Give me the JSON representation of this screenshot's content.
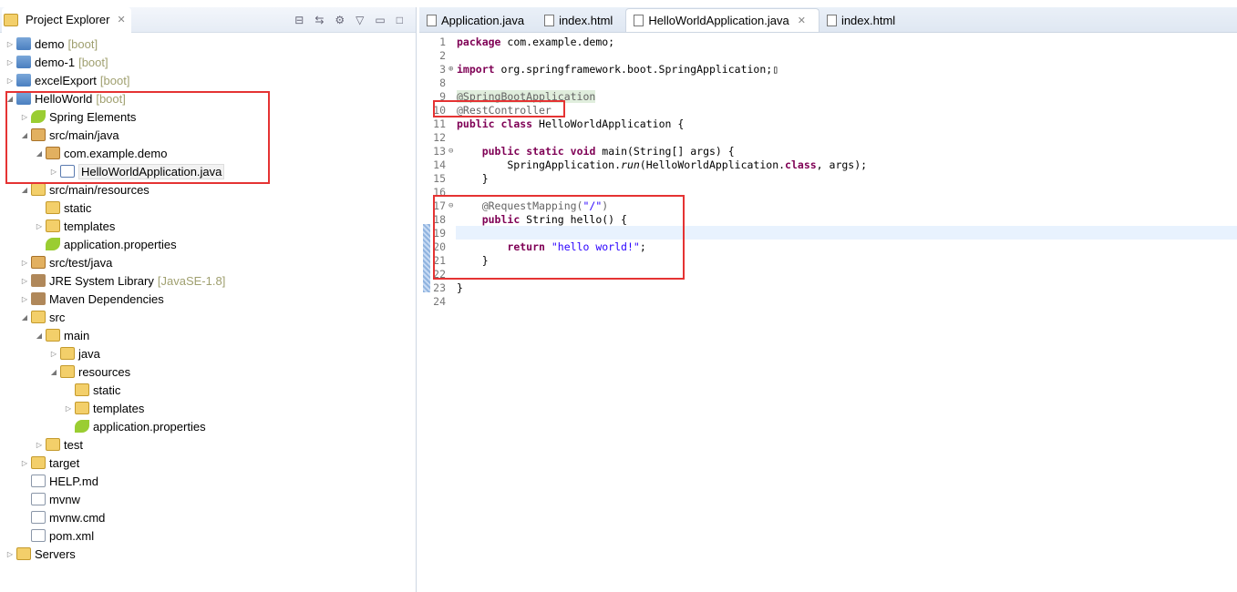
{
  "explorer": {
    "title": "Project Explorer",
    "items": [
      {
        "label": "demo",
        "deco": "[boot]",
        "level": 0,
        "state": "collapsed",
        "icon": "project"
      },
      {
        "label": "demo-1",
        "deco": "[boot]",
        "level": 0,
        "state": "collapsed",
        "icon": "project"
      },
      {
        "label": "excelExport",
        "deco": "[boot]",
        "level": 0,
        "state": "collapsed",
        "icon": "project"
      },
      {
        "label": "HelloWorld",
        "deco": "[boot]",
        "level": 0,
        "state": "expanded",
        "icon": "project"
      },
      {
        "label": "Spring Elements",
        "level": 1,
        "state": "collapsed",
        "icon": "leaf"
      },
      {
        "label": "src/main/java",
        "level": 1,
        "state": "expanded",
        "icon": "pkg"
      },
      {
        "label": "com.example.demo",
        "level": 2,
        "state": "expanded",
        "icon": "pkg"
      },
      {
        "label": "HelloWorldApplication.java",
        "level": 3,
        "state": "collapsed",
        "icon": "java",
        "selected": true
      },
      {
        "label": "src/main/resources",
        "level": 1,
        "state": "expanded",
        "icon": "folder"
      },
      {
        "label": "static",
        "level": 2,
        "state": "none",
        "icon": "folder"
      },
      {
        "label": "templates",
        "level": 2,
        "state": "collapsed",
        "icon": "folder"
      },
      {
        "label": "application.properties",
        "level": 2,
        "state": "none",
        "icon": "leaf"
      },
      {
        "label": "src/test/java",
        "level": 1,
        "state": "collapsed",
        "icon": "pkg"
      },
      {
        "label": "JRE System Library",
        "deco": "[JavaSE-1.8]",
        "level": 1,
        "state": "collapsed",
        "icon": "lib"
      },
      {
        "label": "Maven Dependencies",
        "level": 1,
        "state": "collapsed",
        "icon": "lib"
      },
      {
        "label": "src",
        "level": 1,
        "state": "expanded",
        "icon": "folder"
      },
      {
        "label": "main",
        "level": 2,
        "state": "expanded",
        "icon": "folder"
      },
      {
        "label": "java",
        "level": 3,
        "state": "collapsed",
        "icon": "folder"
      },
      {
        "label": "resources",
        "level": 3,
        "state": "expanded",
        "icon": "folder"
      },
      {
        "label": "static",
        "level": 4,
        "state": "none",
        "icon": "folder"
      },
      {
        "label": "templates",
        "level": 4,
        "state": "collapsed",
        "icon": "folder"
      },
      {
        "label": "application.properties",
        "level": 4,
        "state": "none",
        "icon": "leaf"
      },
      {
        "label": "test",
        "level": 2,
        "state": "collapsed",
        "icon": "folder"
      },
      {
        "label": "target",
        "level": 1,
        "state": "collapsed",
        "icon": "folder"
      },
      {
        "label": "HELP.md",
        "level": 1,
        "state": "none",
        "icon": "file"
      },
      {
        "label": "mvnw",
        "level": 1,
        "state": "none",
        "icon": "file"
      },
      {
        "label": "mvnw.cmd",
        "level": 1,
        "state": "none",
        "icon": "file"
      },
      {
        "label": "pom.xml",
        "level": 1,
        "state": "none",
        "icon": "file"
      },
      {
        "label": "Servers",
        "level": 0,
        "state": "collapsed",
        "icon": "folder"
      }
    ]
  },
  "editor": {
    "tabs": [
      {
        "label": "Application.java",
        "active": false
      },
      {
        "label": "index.html",
        "active": false
      },
      {
        "label": "HelloWorldApplication.java",
        "active": true
      },
      {
        "label": "index.html",
        "active": false
      }
    ],
    "lines": [
      {
        "n": "1",
        "segs": [
          [
            "package",
            "kw"
          ],
          [
            " com.example.demo;",
            ""
          ]
        ]
      },
      {
        "n": "2",
        "segs": []
      },
      {
        "n": "3",
        "marker": "⊕",
        "segs": [
          [
            "import",
            "kw"
          ],
          [
            " org.springframework.boot.SpringApplication;",
            ""
          ],
          [
            "▯",
            ""
          ]
        ]
      },
      {
        "n": "8",
        "segs": []
      },
      {
        "n": "9",
        "segs": [
          [
            "@SpringBootApplication",
            "ann hl"
          ]
        ]
      },
      {
        "n": "10",
        "segs": [
          [
            "@RestController",
            "ann"
          ]
        ]
      },
      {
        "n": "11",
        "segs": [
          [
            "public",
            "kw"
          ],
          [
            " ",
            ""
          ],
          [
            "class",
            "kw"
          ],
          [
            " HelloWorldApplication {",
            ""
          ]
        ]
      },
      {
        "n": "12",
        "segs": []
      },
      {
        "n": "13",
        "marker": "⊖",
        "segs": [
          [
            "    ",
            ""
          ],
          [
            "public",
            "kw"
          ],
          [
            " ",
            ""
          ],
          [
            "static",
            "kw"
          ],
          [
            " ",
            ""
          ],
          [
            "void",
            "kw"
          ],
          [
            " main(String[] args) {",
            ""
          ]
        ]
      },
      {
        "n": "14",
        "segs": [
          [
            "        SpringApplication.",
            ""
          ],
          [
            "run",
            "it"
          ],
          [
            "(HelloWorldApplication.",
            ""
          ],
          [
            "class",
            "kw"
          ],
          [
            ", args);",
            ""
          ]
        ]
      },
      {
        "n": "15",
        "segs": [
          [
            "    }",
            ""
          ]
        ]
      },
      {
        "n": "16",
        "segs": []
      },
      {
        "n": "17",
        "marker": "⊖",
        "segs": [
          [
            "    ",
            ""
          ],
          [
            "@RequestMapping(",
            "ann"
          ],
          [
            "\"/\"",
            "str"
          ],
          [
            ")",
            "ann"
          ]
        ]
      },
      {
        "n": "18",
        "segs": [
          [
            "    ",
            ""
          ],
          [
            "public",
            "kw"
          ],
          [
            " String hello() {",
            ""
          ]
        ]
      },
      {
        "n": "19",
        "current": true,
        "segs": []
      },
      {
        "n": "20",
        "segs": [
          [
            "        ",
            ""
          ],
          [
            "return",
            "kw"
          ],
          [
            " ",
            ""
          ],
          [
            "\"hello world!\"",
            "str"
          ],
          [
            ";",
            ""
          ]
        ]
      },
      {
        "n": "21",
        "segs": [
          [
            "    }",
            ""
          ]
        ]
      },
      {
        "n": "22",
        "segs": []
      },
      {
        "n": "23",
        "segs": [
          [
            "}",
            ""
          ]
        ]
      },
      {
        "n": "24",
        "segs": []
      }
    ]
  },
  "colors": {
    "highlight_box": "#e53333",
    "keyword": "#7f0055",
    "string": "#2a00ff"
  }
}
